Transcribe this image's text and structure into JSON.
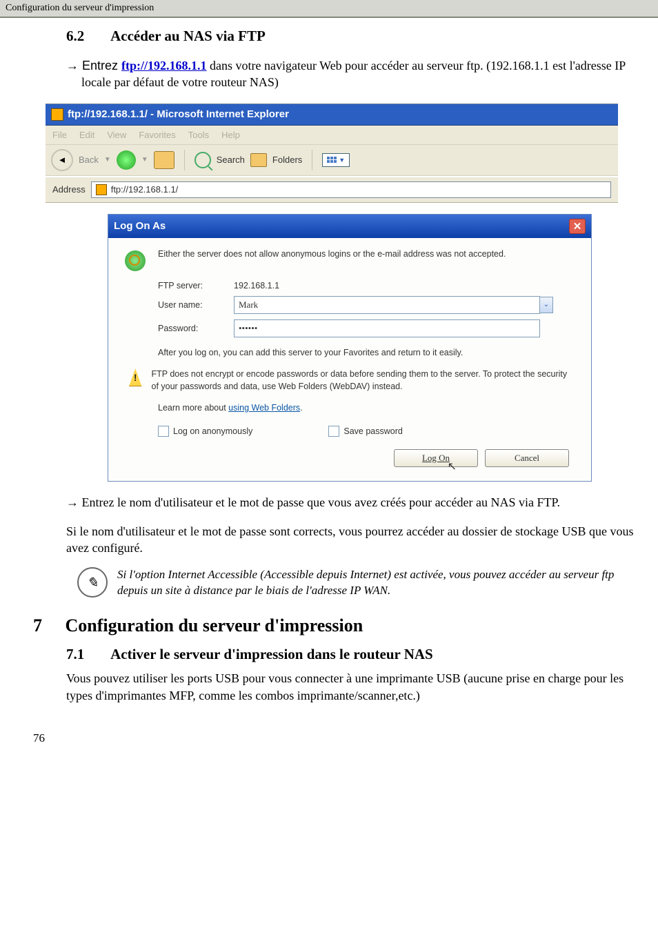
{
  "header": {
    "text": "Configuration du serveur d'impression"
  },
  "section62": {
    "num": "6.2",
    "title": "Accéder au NAS via FTP",
    "bullet1_prefix": "→ Entrez ",
    "bullet1_link": "ftp://192.168.1.1",
    "bullet1_suffix": " dans votre navigateur Web pour accéder au serveur ftp. (192.168.1.1 est l'adresse IP locale par défaut de votre routeur NAS)"
  },
  "ie": {
    "title": "ftp://192.168.1.1/ - Microsoft Internet Explorer",
    "menu": {
      "file": "File",
      "edit": "Edit",
      "view": "View",
      "favorites": "Favorites",
      "tools": "Tools",
      "help": "Help"
    },
    "toolbar": {
      "back": "Back",
      "search": "Search",
      "folders": "Folders"
    },
    "address_label": "Address",
    "address_value": "ftp://192.168.1.1/"
  },
  "dialog": {
    "title": "Log On As",
    "intro": "Either the server does not allow anonymous logins or the e-mail address was not accepted.",
    "ftp_label": "FTP server:",
    "ftp_value": "192.168.1.1",
    "user_label": "User name:",
    "user_value": "Mark",
    "pass_label": "Password:",
    "pass_value": "••••••",
    "after": "After you log on, you can add this server to your Favorites and return to it easily.",
    "warn": "FTP does not encrypt or encode passwords or data before sending them to the server.  To protect the security of your passwords and data, use Web Folders (WebDAV) instead.",
    "learn_prefix": "Learn more about ",
    "learn_link": "using Web Folders",
    "learn_suffix": ".",
    "chk_anon": "Log on anonymously",
    "chk_save": "Save password",
    "btn_logon": "Log On",
    "btn_cancel": "Cancel"
  },
  "after_dialog": {
    "bullet": "→ Entrez le nom d'utilisateur et le mot de passe que vous avez créés pour accéder au NAS via FTP.",
    "para": "Si le nom d'utilisateur et le mot de passe sont corrects, vous pourrez accéder au dossier de stockage USB que vous avez configuré."
  },
  "note": {
    "text": "Si l'option Internet Accessible (Accessible depuis Internet) est activée, vous pouvez accéder au serveur ftp depuis un site à distance par le biais de l'adresse IP WAN."
  },
  "section7": {
    "num": "7",
    "title": "Configuration du serveur d'impression"
  },
  "section71": {
    "num": "7.1",
    "title": "Activer le serveur d'impression dans le routeur NAS",
    "para": "Vous pouvez utiliser les ports USB pour vous connecter à une imprimante USB (aucune prise en charge pour les types d'imprimantes MFP, comme les combos imprimante/scanner,etc.)"
  },
  "page_number": "76"
}
